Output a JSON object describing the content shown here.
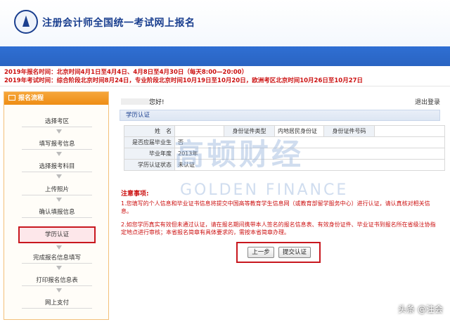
{
  "header": {
    "title": "注册会计师全国统一考试网上报名"
  },
  "notice": {
    "line1": "2019年报名时间：北京时间4月1日至4月4日、4月8日至4月30日（每天8:00—20:00）",
    "line2": "2019年考试时间：综合阶段北京时间8月24日，专业阶段北京时间10月19日至10月20日，欧洲考区北京时间10月26日至10月27日"
  },
  "sidebar": {
    "title": "报名流程",
    "steps": [
      {
        "label": "选择考区"
      },
      {
        "label": "填写报考信息"
      },
      {
        "label": "选择报考科目"
      },
      {
        "label": "上传照片"
      },
      {
        "label": "确认填报信息"
      },
      {
        "label": "学历认证"
      },
      {
        "label": "完成报名信息填写"
      },
      {
        "label": "打印报名信息表"
      },
      {
        "label": "网上支付"
      }
    ],
    "active_index": 5
  },
  "main": {
    "greeting": "您好!",
    "logout": "退出登录",
    "section_title": "学历认证",
    "table": {
      "name_label": "姓　名",
      "name_value": "",
      "id_type_label": "身份证件类型",
      "id_type_value": "内地居民身份证",
      "id_no_label": "身份证件号码",
      "id_no_value": "",
      "fresh_grad_label": "是否应届毕业生",
      "fresh_grad_value": "否",
      "grad_year_label": "毕业年度",
      "grad_year_value": "2013年",
      "status_label": "学历认证状态",
      "status_value": "未认证"
    },
    "notes_title": "注意事项:",
    "note1": "1.您填写的个人信息和毕业证书信息将提交中国高等教育学生信息网（或教育部留学服务中心）进行认证，请认真核对相关信息。",
    "note2": "2.如您学历真实有效但未通过认证，请在报名期间携带本人签名的报名信息表、有效身份证件、毕业证书到报名所在省级注协指定地点进行审核；本省报名简章有具体要求的，需按本省简章办理。",
    "prev_button": "上一步",
    "submit_button": "提交认证"
  },
  "watermark": {
    "cn": "高顿财经",
    "en": "GOLDEN FINANCE"
  },
  "footer_brand": "头条 @注会",
  "colors": {
    "accent_blue": "#2f6fd3",
    "alert_red": "#cc1111",
    "sidebar_orange": "#ee8d15",
    "highlight_border": "#c8171e"
  }
}
